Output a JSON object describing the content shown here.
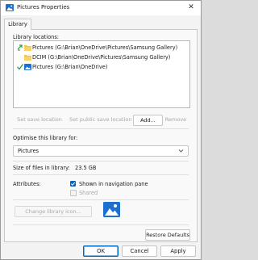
{
  "window": {
    "title": "Pictures Properties",
    "close_glyph": "✕"
  },
  "tabs": [
    {
      "label": "Library"
    }
  ],
  "library_locations": {
    "label": "Library locations:",
    "items": [
      {
        "text": "Pictures (G:\\Brian\\OneDrive\\Pictures\\Samsung Gallery)",
        "icon": "folder-icon",
        "marker": "save-location-arrow-icon"
      },
      {
        "text": "DCIM (G:\\Brian\\OneDrive\\Pictures\\Samsung Gallery)",
        "icon": "folder-icon",
        "marker": ""
      },
      {
        "text": "Pictures (G:\\Brian\\OneDrive)",
        "icon": "pictures-library-icon",
        "marker": "checkmark-icon"
      }
    ]
  },
  "location_buttons": {
    "set_save": "Set save location",
    "set_public_save": "Set public save location",
    "add": "Add...",
    "remove": "Remove"
  },
  "optimise": {
    "label": "Optimise this library for:",
    "selected": "Pictures"
  },
  "size": {
    "label": "Size of files in library:",
    "value": "23.5 GB"
  },
  "attributes": {
    "label": "Attributes:",
    "shown_in_nav": "Shown in navigation pane",
    "shown_in_nav_checked": true,
    "shared": "Shared",
    "shared_checked": false
  },
  "change_icon_button": "Change library icon...",
  "restore_defaults_button": "Restore Defaults",
  "footer": {
    "ok": "OK",
    "cancel": "Cancel",
    "apply": "Apply"
  },
  "colors": {
    "accent": "#0067c0",
    "folder": "#f5c342",
    "check": "#2e9a3a"
  }
}
